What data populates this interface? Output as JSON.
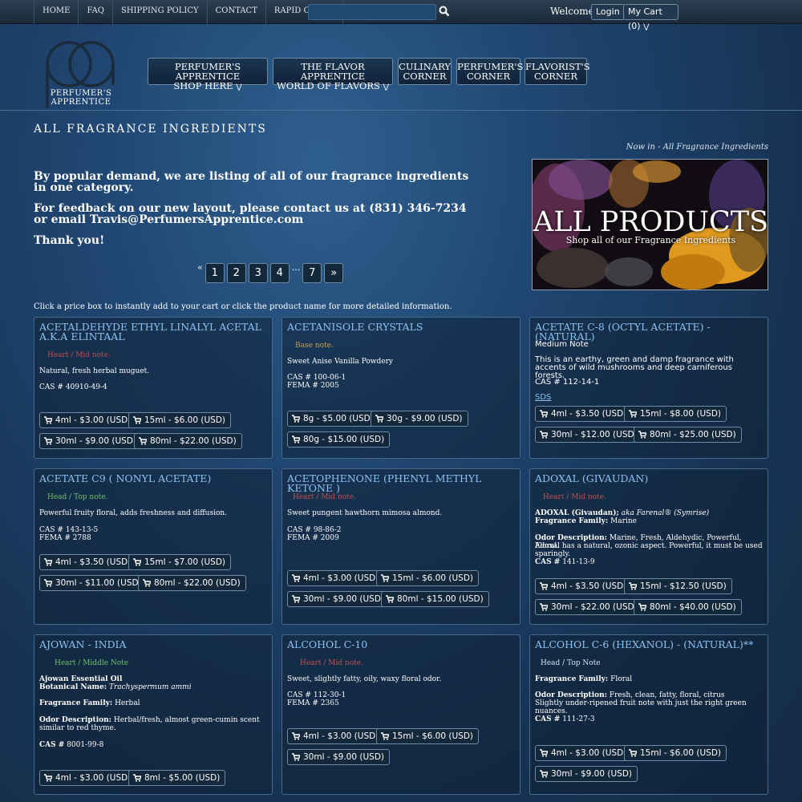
{
  "topnav": {
    "home": "HOME",
    "faq": "FAQ",
    "shipping": "SHIPPING POLICY",
    "contact": "CONTACT",
    "rapid": "RAPID ORDER",
    "welcome": "Welcome !",
    "login": "Login",
    "cart": "My Cart (0)"
  },
  "logo": {
    "line1": "PERFUMER'S",
    "line2": "APPRENTICE"
  },
  "mainnav": [
    {
      "l1": "PERFUMER'S APPRENTICE",
      "l2": "SHOP HERE"
    },
    {
      "l1": "THE FLAVOR APPRENTICE",
      "l2": "WORLD OF FLAVORS"
    },
    {
      "l1": "CULINARY",
      "l2": "CORNER"
    },
    {
      "l1": "PERFUMER'S",
      "l2": "CORNER"
    },
    {
      "l1": "FLAVORIST'S",
      "l2": "CORNER"
    }
  ],
  "page": {
    "title": "ALL FRAGRANCE INGREDIENTS",
    "crumb": "Now in - All Fragrance Ingredients",
    "intro1": "By popular demand, we are listing of all of our fragrance ingredients in one category.",
    "intro2": "For feedback on our new layout, please contact us at (831) 346-7234 or email Travis@PerfumersApprentice.com",
    "intro3": "Thank you!",
    "hint": "Click a price box to instantly add to your cart or click the product name for more detailed information."
  },
  "banner": {
    "title": "ALL PRODUCTS",
    "sub": "Shop all of our Fragrance Ingredients"
  },
  "pager": {
    "prev": "«",
    "p1": "1",
    "p2": "2",
    "p3": "3",
    "p4": "4",
    "dots": "...",
    "p7": "7",
    "next": "»"
  },
  "colors": {
    "note_heart": "#c0504d",
    "note_base": "#c8a050",
    "note_top": "#6fc06a",
    "note_topw": "#d8e4ee",
    "link": "#8cc1ef"
  },
  "products": [
    {
      "name": "ACETALDEHYDE ETHYL LINALYL ACETAL A.K.A ELINTAAL",
      "note": "Heart / Mid note.",
      "desc": "Natural, fresh herbal muguet.",
      "cas": "CAS # 40910-49-4",
      "prices": [
        "4ml - $3.00 (USD)",
        "15ml - $6.00 (USD)",
        "30ml - $9.00 (USD)",
        "80ml - $22.00 (USD)"
      ]
    },
    {
      "name": "ACETANISOLE CRYSTALS",
      "note": "Base note.",
      "desc": "Sweet Anise Vanilla Powdery",
      "cas": "CAS # 100-06-1",
      "fema": "FEMA # 2005",
      "prices": [
        "8g - $5.00 (USD)",
        "30g - $9.00 (USD)",
        "80g - $15.00 (USD)"
      ]
    },
    {
      "name": "ACETATE C-8 (OCTYL ACETATE) - (NATURAL)",
      "note": "Medium Note",
      "desc": "This is an earthy, green and damp fragrance with accents of wild mushrooms and deep carniferous forests.",
      "cas": "CAS # 112-14-1",
      "sds": "SDS",
      "prices": [
        "4ml - $3.50 (USD)",
        "15ml - $8.00 (USD)",
        "30ml - $12.00 (USD)",
        "80ml - $25.00 (USD)"
      ]
    },
    {
      "name": "ACETATE C9 ( NONYL ACETATE)",
      "note": "Head / Top note.",
      "desc": "Powerful fruity floral, adds freshness and diffusion.",
      "cas": "CAS # 143-13-5",
      "fema": "FEMA # 2788",
      "prices": [
        "4ml - $3.50 (USD)",
        "15ml - $7.00 (USD)",
        "30ml - $11.00 (USD)",
        "80ml - $22.00 (USD)"
      ]
    },
    {
      "name": "ACETOPHENONE (PHENYL METHYL KETONE )",
      "note": "Heart / Mid note.",
      "desc": "Sweet pungent hawthorn mimosa almond.",
      "cas": "CAS # 98-86-2",
      "fema": "FEMA # 2009",
      "prices": [
        "4ml - $3.00 (USD)",
        "15ml - $6.00 (USD)",
        "30ml - $9.00 (USD)",
        "80ml - $15.00 (USD)"
      ]
    },
    {
      "name": "ADOXAL (GIVAUDAN)",
      "note": "Heart / Mid note.",
      "l1b": "ADOXAL (Givaudan);",
      "l1i": "aka Farenal® (Symrise)",
      "famlabel": "Fragrance Family:",
      "fam": "Marine",
      "odorlabel": "Odor Description:",
      "odor": "Marine, Fresh, Aldehydic, Powerful, Floral.",
      "extra": "Adoxal has a natural, ozonic aspect. Powerful, it must be used sparingly.",
      "caslabel": "CAS #",
      "cas": "141-13-9",
      "prices": [
        "4ml - $3.50 (USD)",
        "15ml - $12.50 (USD)",
        "30ml - $22.00 (USD)",
        "80ml - $40.00 (USD)"
      ]
    },
    {
      "name": "AJOWAN - INDIA",
      "note": "Heart / Middle Note",
      "l1b": "Ajowan Essential Oil",
      "botlabel": "Botanical Name:",
      "bot": "Trachyspermum ammi",
      "famlabel": "Fragrance Family:",
      "fam": "Herbal",
      "odorlabel": "Odor Description:",
      "odor": "Herbal/fresh, almost green-cumin scent similar to red thyme.",
      "caslabel": "CAS #",
      "cas": "8001-99-8",
      "prices": [
        "4ml - $3.00 (USD)",
        "8ml - $5.00 (USD)"
      ]
    },
    {
      "name": "ALCOHOL C-10",
      "note": "Heart / Mid note.",
      "desc": "Sweet, slightly fatty, oily, waxy floral odor.",
      "cas": "CAS # 112-30-1",
      "fema": "FEMA # 2365",
      "prices": [
        "4ml - $3.00 (USD)",
        "15ml - $6.00 (USD)",
        "30ml - $9.00 (USD)"
      ]
    },
    {
      "name": "ALCOHOL C-6 (HEXANOL) - (NATURAL)**",
      "note": "Head / Top Note",
      "famlabel": "Fragrance Family:",
      "fam": "Floral",
      "odorlabel": "Odor Description:",
      "odor": "Fresh, clean, fatty, floral, citrus",
      "extra": "Slightly under-ripened fruit note with just the right green nuances.",
      "caslabel": "CAS #",
      "cas": "111-27-3",
      "prices": [
        "4ml - $3.00 (USD)",
        "15ml - $6.00 (USD)",
        "30ml - $9.00 (USD)"
      ]
    }
  ]
}
